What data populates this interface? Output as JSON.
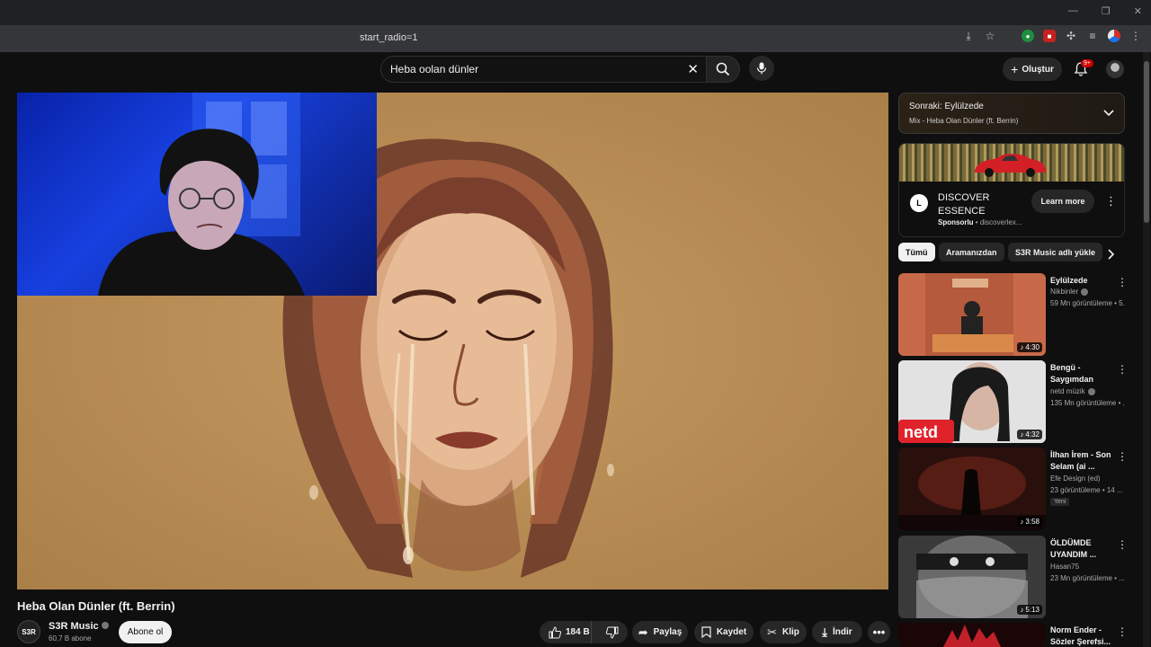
{
  "browser": {
    "url_fragment": "start_radio=1"
  },
  "header": {
    "search_value": "Heba oolan dünler",
    "create_label": "Oluştur",
    "notification_count": "9+"
  },
  "video": {
    "title": "Heba Olan Dünler (ft. Berrin)",
    "channel_avatar_text": "S3R",
    "channel_name": "S3R Music",
    "subscribers": "60,7 B abone",
    "subscribe_label": "Abone ol",
    "likes": "184 B",
    "share_label": "Paylaş",
    "save_label": "Kaydet",
    "clip_label": "Klip",
    "download_label": "İndir"
  },
  "sidebar": {
    "up_next_title": "Sonraki: Eylülzede",
    "up_next_sub": "Mix - Heba Olan Dünler (ft. Berrin)",
    "ad": {
      "title": "DISCOVER ESSENCE",
      "sponsored": "Sponsorlu",
      "domain": "discoverlex...",
      "cta": "Learn more"
    },
    "chips": [
      "Tümü",
      "Aramanızdan",
      "S3R Music adlı yükle"
    ],
    "recommendations": [
      {
        "title": "Eylülzede",
        "channel": "Nikbinler",
        "meta": "59 Mn görüntüleme • 5...",
        "duration": "4:30",
        "verified": true
      },
      {
        "title": "Bengü - Saygımdan",
        "channel": "netd müzik",
        "meta": "135 Mn görüntüleme • ...",
        "duration": "4:32",
        "verified": true
      },
      {
        "title": "İlhan İrem - Son Selam (ai ...",
        "channel": "Efe Design (ed)",
        "meta": "23 görüntüleme • 14 ...",
        "duration": "3:58",
        "badge": "Yeni",
        "verified": false
      },
      {
        "title": "ÖLDÜMDE UYANDIM ...",
        "channel": "Hasan75",
        "meta": "23 Mn görüntüleme • ...",
        "duration": "5:13",
        "verified": false
      },
      {
        "title": "Norm Ender - Sözler Şerefsi...",
        "channel": "",
        "meta": "",
        "duration": "",
        "verified": false
      }
    ]
  }
}
